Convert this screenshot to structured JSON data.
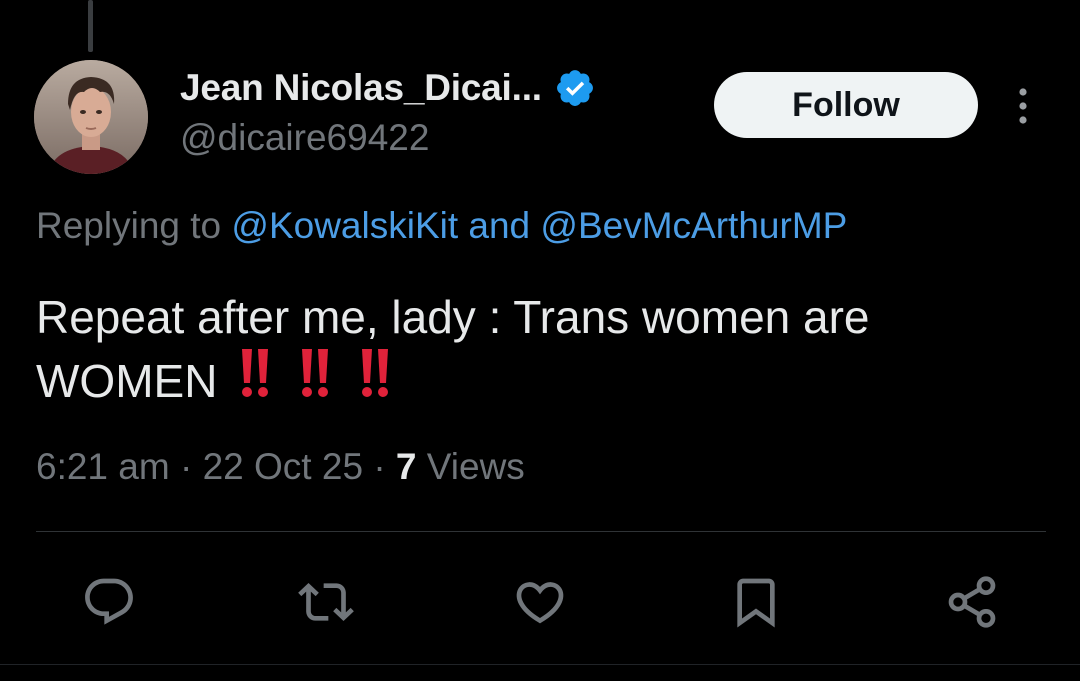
{
  "post": {
    "author": {
      "display_name": "Jean Nicolas_Dicai...",
      "handle": "@dicaire69422",
      "verified": true
    },
    "follow_label": "Follow",
    "replying": {
      "prefix": "Replying to ",
      "mention_1": "@KowalskiKit",
      "joiner": " and ",
      "mention_2": "@BevMcArthurMP"
    },
    "text": "Repeat after me, lady : Trans women are WOMEN",
    "emoji": "‼️‼️‼️",
    "meta": {
      "time": "6:21 am",
      "date": "22 Oct 25",
      "views_count": "7",
      "views_label": "Views",
      "separator": "·"
    }
  },
  "actions": [
    {
      "name": "reply-icon"
    },
    {
      "name": "repost-icon"
    },
    {
      "name": "like-icon"
    },
    {
      "name": "bookmark-icon"
    },
    {
      "name": "share-icon"
    }
  ],
  "colors": {
    "background": "#000000",
    "text": "#e7e9ea",
    "muted": "#71767b",
    "link": "#4c9de5",
    "verified": "#1d9bf0",
    "emoji_red": "#e0223a"
  }
}
